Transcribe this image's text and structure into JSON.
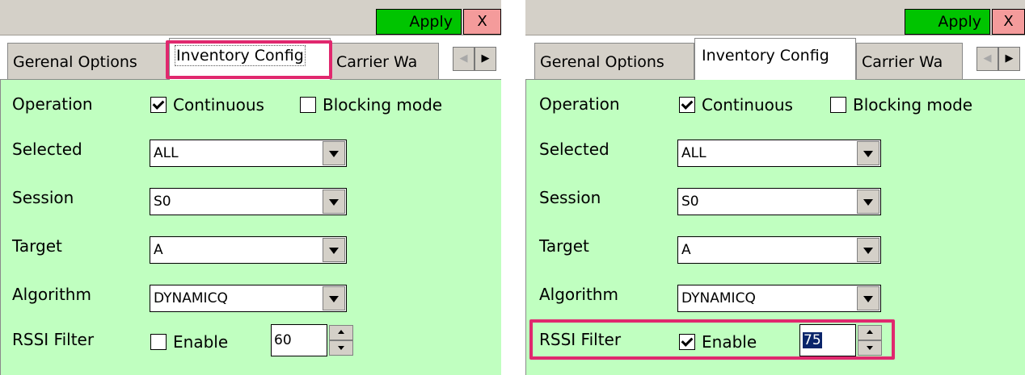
{
  "colors": {
    "apply_bg": "#00c400",
    "close_bg": "#f49b9b",
    "content_bg": "#c0ffc0",
    "highlight": "#e0286e",
    "selection": "#0a246a"
  },
  "toolbar": {
    "apply_label": "Apply",
    "close_label": "X"
  },
  "tabs": {
    "general": "Gerenal Options",
    "inventory": "Inventory Config",
    "carrier": "Carrier Wa"
  },
  "scroll": {
    "left_icon": "◀",
    "right_icon": "▶"
  },
  "labels": {
    "operation": "Operation",
    "selected": "Selected",
    "session": "Session",
    "target": "Target",
    "algorithm": "Algorithm",
    "rssi_filter": "RSSI Filter"
  },
  "checkbox_labels": {
    "continuous": "Continuous",
    "blocking_mode": "Blocking mode",
    "enable": "Enable"
  },
  "left": {
    "continuous_checked": true,
    "blocking_checked": false,
    "selected_value": "ALL",
    "session_value": "S0",
    "target_value": "A",
    "algorithm_value": "DYNAMICQ",
    "rssi_enable_checked": false,
    "rssi_value": "60"
  },
  "right": {
    "continuous_checked": true,
    "blocking_checked": false,
    "selected_value": "ALL",
    "session_value": "S0",
    "target_value": "A",
    "algorithm_value": "DYNAMICQ",
    "rssi_enable_checked": true,
    "rssi_value": "75"
  }
}
